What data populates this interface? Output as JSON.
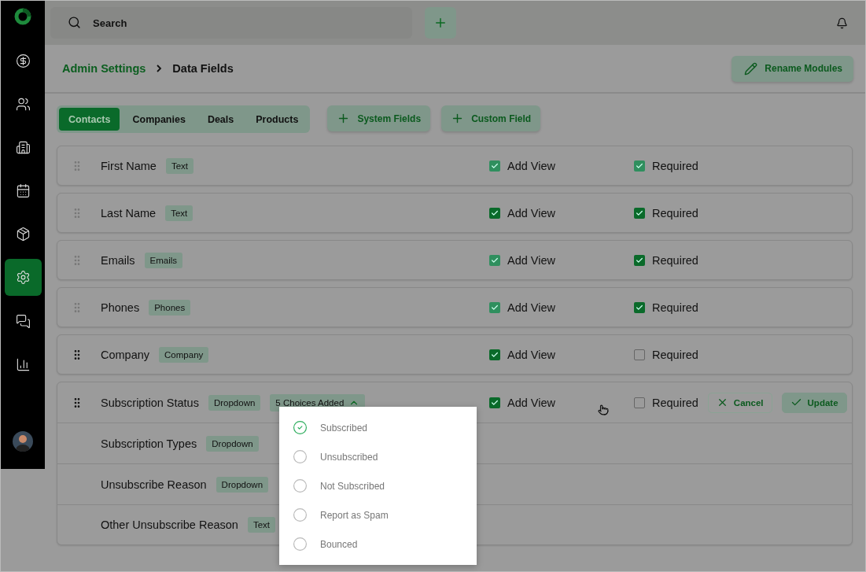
{
  "sidebar": {
    "items": [
      {
        "selected": false
      },
      {
        "selected": false
      },
      {
        "selected": false
      },
      {
        "selected": false
      },
      {
        "selected": false
      },
      {
        "selected": true
      },
      {
        "selected": false
      },
      {
        "selected": false
      }
    ]
  },
  "search": {
    "placeholder": "Search"
  },
  "breadcrumb": [
    {
      "label": "Admin Settings",
      "kind": "link"
    },
    {
      "label": "Data Fields",
      "kind": "current"
    }
  ],
  "rename_button": "Rename Modules",
  "module_tabs": [
    {
      "label": "Contacts",
      "selected": true
    },
    {
      "label": "Companies",
      "selected": false
    },
    {
      "label": "Deals",
      "selected": false
    },
    {
      "label": "Products",
      "selected": false
    }
  ],
  "add_buttons": [
    "System Fields",
    "Custom Field"
  ],
  "fields": [
    {
      "name": "First Name",
      "type": "Text",
      "locked": true,
      "add_view": {
        "label": "Add View",
        "checked": true,
        "disabled": true
      },
      "required": {
        "label": "Required",
        "checked": true,
        "disabled": true
      }
    },
    {
      "name": "Last Name",
      "type": "Text",
      "locked": true,
      "add_view": {
        "label": "Add View",
        "checked": true,
        "disabled": false
      },
      "required": {
        "label": "Required",
        "checked": true,
        "disabled": false
      }
    },
    {
      "name": "Emails",
      "type": "Emails",
      "locked": true,
      "add_view": {
        "label": "Add View",
        "checked": true,
        "disabled": true
      },
      "required": {
        "label": "Required",
        "checked": true,
        "disabled": false
      }
    },
    {
      "name": "Phones",
      "type": "Phones",
      "locked": true,
      "add_view": {
        "label": "Add View",
        "checked": true,
        "disabled": true
      },
      "required": {
        "label": "Required",
        "checked": true,
        "disabled": false
      }
    },
    {
      "name": "Company",
      "type": "Company",
      "locked": false,
      "add_view": {
        "label": "Add View",
        "checked": true,
        "disabled": false
      },
      "required": {
        "label": "Required",
        "checked": false,
        "disabled": false
      }
    },
    {
      "name": "Subscription Status",
      "type": "Dropdown",
      "locked": false,
      "add_view": {
        "label": "Add View",
        "checked": true,
        "disabled": false
      },
      "required": {
        "label": "Required",
        "checked": false,
        "disabled": false
      },
      "choices": {
        "label": "5 Choices Added",
        "expanded": true,
        "options": [
          {
            "label": "Subscribed",
            "selected": true
          },
          {
            "label": "Unsubscribed",
            "selected": false
          },
          {
            "label": "Not Subscribed",
            "selected": false
          },
          {
            "label": "Report as Spam",
            "selected": false
          },
          {
            "label": "Bounced",
            "selected": false
          }
        ]
      },
      "actions": [
        {
          "label": "Cancel",
          "kind": "cancel"
        },
        {
          "label": "Update",
          "kind": "update"
        }
      ],
      "children": [
        {
          "name": "Subscription Types",
          "type": "Dropdown"
        },
        {
          "name": "Unsubscribe Reason",
          "type": "Dropdown"
        },
        {
          "name": "Other Unsubscribe Reason",
          "type": "Text"
        }
      ]
    }
  ]
}
